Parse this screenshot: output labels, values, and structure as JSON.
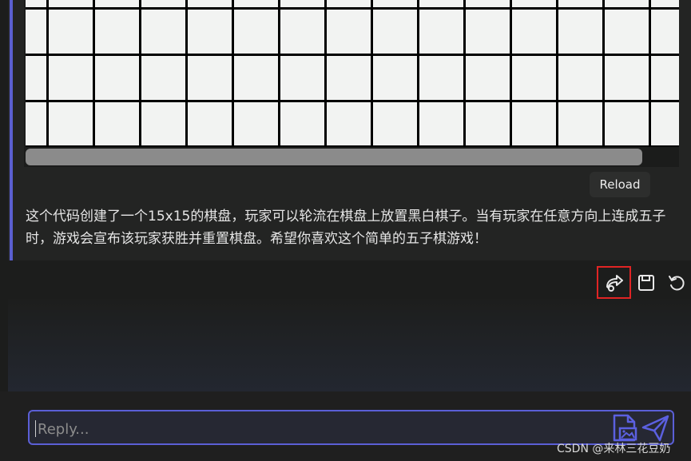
{
  "tooltip": {
    "reload": "Reload"
  },
  "message": {
    "text": "这个代码创建了一个15x15的棋盘，玩家可以轮流在棋盘上放置黑白棋子。当有玩家在任意方向上连成五子时，游戏会宣布该玩家获胜并重置棋盘。希望你喜欢这个简单的五子棋游戏！"
  },
  "actions": {
    "icons": [
      "share-icon",
      "save-icon",
      "reload-icon"
    ]
  },
  "reply": {
    "placeholder": "Reply..."
  },
  "watermark": "CSDN @来林三花豆奶",
  "colors": {
    "accent": "#5a5fd0",
    "highlight": "#e02424",
    "board_cell": "#f2f3f2"
  }
}
